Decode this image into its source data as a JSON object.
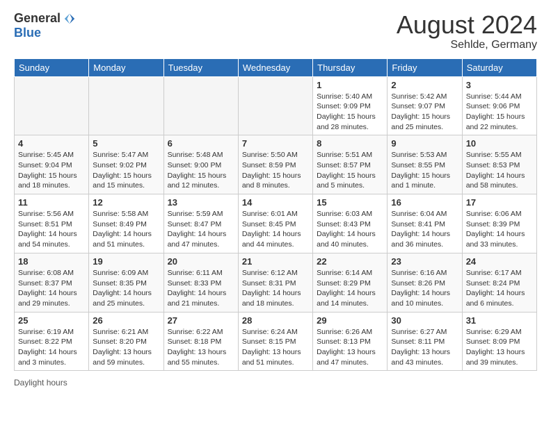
{
  "header": {
    "logo_general": "General",
    "logo_blue": "Blue",
    "month_title": "August 2024",
    "location": "Sehlde, Germany"
  },
  "days_of_week": [
    "Sunday",
    "Monday",
    "Tuesday",
    "Wednesday",
    "Thursday",
    "Friday",
    "Saturday"
  ],
  "weeks": [
    [
      {
        "day": "",
        "info": ""
      },
      {
        "day": "",
        "info": ""
      },
      {
        "day": "",
        "info": ""
      },
      {
        "day": "",
        "info": ""
      },
      {
        "day": "1",
        "info": "Sunrise: 5:40 AM\nSunset: 9:09 PM\nDaylight: 15 hours and 28 minutes."
      },
      {
        "day": "2",
        "info": "Sunrise: 5:42 AM\nSunset: 9:07 PM\nDaylight: 15 hours and 25 minutes."
      },
      {
        "day": "3",
        "info": "Sunrise: 5:44 AM\nSunset: 9:06 PM\nDaylight: 15 hours and 22 minutes."
      }
    ],
    [
      {
        "day": "4",
        "info": "Sunrise: 5:45 AM\nSunset: 9:04 PM\nDaylight: 15 hours and 18 minutes."
      },
      {
        "day": "5",
        "info": "Sunrise: 5:47 AM\nSunset: 9:02 PM\nDaylight: 15 hours and 15 minutes."
      },
      {
        "day": "6",
        "info": "Sunrise: 5:48 AM\nSunset: 9:00 PM\nDaylight: 15 hours and 12 minutes."
      },
      {
        "day": "7",
        "info": "Sunrise: 5:50 AM\nSunset: 8:59 PM\nDaylight: 15 hours and 8 minutes."
      },
      {
        "day": "8",
        "info": "Sunrise: 5:51 AM\nSunset: 8:57 PM\nDaylight: 15 hours and 5 minutes."
      },
      {
        "day": "9",
        "info": "Sunrise: 5:53 AM\nSunset: 8:55 PM\nDaylight: 15 hours and 1 minute."
      },
      {
        "day": "10",
        "info": "Sunrise: 5:55 AM\nSunset: 8:53 PM\nDaylight: 14 hours and 58 minutes."
      }
    ],
    [
      {
        "day": "11",
        "info": "Sunrise: 5:56 AM\nSunset: 8:51 PM\nDaylight: 14 hours and 54 minutes."
      },
      {
        "day": "12",
        "info": "Sunrise: 5:58 AM\nSunset: 8:49 PM\nDaylight: 14 hours and 51 minutes."
      },
      {
        "day": "13",
        "info": "Sunrise: 5:59 AM\nSunset: 8:47 PM\nDaylight: 14 hours and 47 minutes."
      },
      {
        "day": "14",
        "info": "Sunrise: 6:01 AM\nSunset: 8:45 PM\nDaylight: 14 hours and 44 minutes."
      },
      {
        "day": "15",
        "info": "Sunrise: 6:03 AM\nSunset: 8:43 PM\nDaylight: 14 hours and 40 minutes."
      },
      {
        "day": "16",
        "info": "Sunrise: 6:04 AM\nSunset: 8:41 PM\nDaylight: 14 hours and 36 minutes."
      },
      {
        "day": "17",
        "info": "Sunrise: 6:06 AM\nSunset: 8:39 PM\nDaylight: 14 hours and 33 minutes."
      }
    ],
    [
      {
        "day": "18",
        "info": "Sunrise: 6:08 AM\nSunset: 8:37 PM\nDaylight: 14 hours and 29 minutes."
      },
      {
        "day": "19",
        "info": "Sunrise: 6:09 AM\nSunset: 8:35 PM\nDaylight: 14 hours and 25 minutes."
      },
      {
        "day": "20",
        "info": "Sunrise: 6:11 AM\nSunset: 8:33 PM\nDaylight: 14 hours and 21 minutes."
      },
      {
        "day": "21",
        "info": "Sunrise: 6:12 AM\nSunset: 8:31 PM\nDaylight: 14 hours and 18 minutes."
      },
      {
        "day": "22",
        "info": "Sunrise: 6:14 AM\nSunset: 8:29 PM\nDaylight: 14 hours and 14 minutes."
      },
      {
        "day": "23",
        "info": "Sunrise: 6:16 AM\nSunset: 8:26 PM\nDaylight: 14 hours and 10 minutes."
      },
      {
        "day": "24",
        "info": "Sunrise: 6:17 AM\nSunset: 8:24 PM\nDaylight: 14 hours and 6 minutes."
      }
    ],
    [
      {
        "day": "25",
        "info": "Sunrise: 6:19 AM\nSunset: 8:22 PM\nDaylight: 14 hours and 3 minutes."
      },
      {
        "day": "26",
        "info": "Sunrise: 6:21 AM\nSunset: 8:20 PM\nDaylight: 13 hours and 59 minutes."
      },
      {
        "day": "27",
        "info": "Sunrise: 6:22 AM\nSunset: 8:18 PM\nDaylight: 13 hours and 55 minutes."
      },
      {
        "day": "28",
        "info": "Sunrise: 6:24 AM\nSunset: 8:15 PM\nDaylight: 13 hours and 51 minutes."
      },
      {
        "day": "29",
        "info": "Sunrise: 6:26 AM\nSunset: 8:13 PM\nDaylight: 13 hours and 47 minutes."
      },
      {
        "day": "30",
        "info": "Sunrise: 6:27 AM\nSunset: 8:11 PM\nDaylight: 13 hours and 43 minutes."
      },
      {
        "day": "31",
        "info": "Sunrise: 6:29 AM\nSunset: 8:09 PM\nDaylight: 13 hours and 39 minutes."
      }
    ]
  ],
  "footer": {
    "daylight_label": "Daylight hours"
  }
}
